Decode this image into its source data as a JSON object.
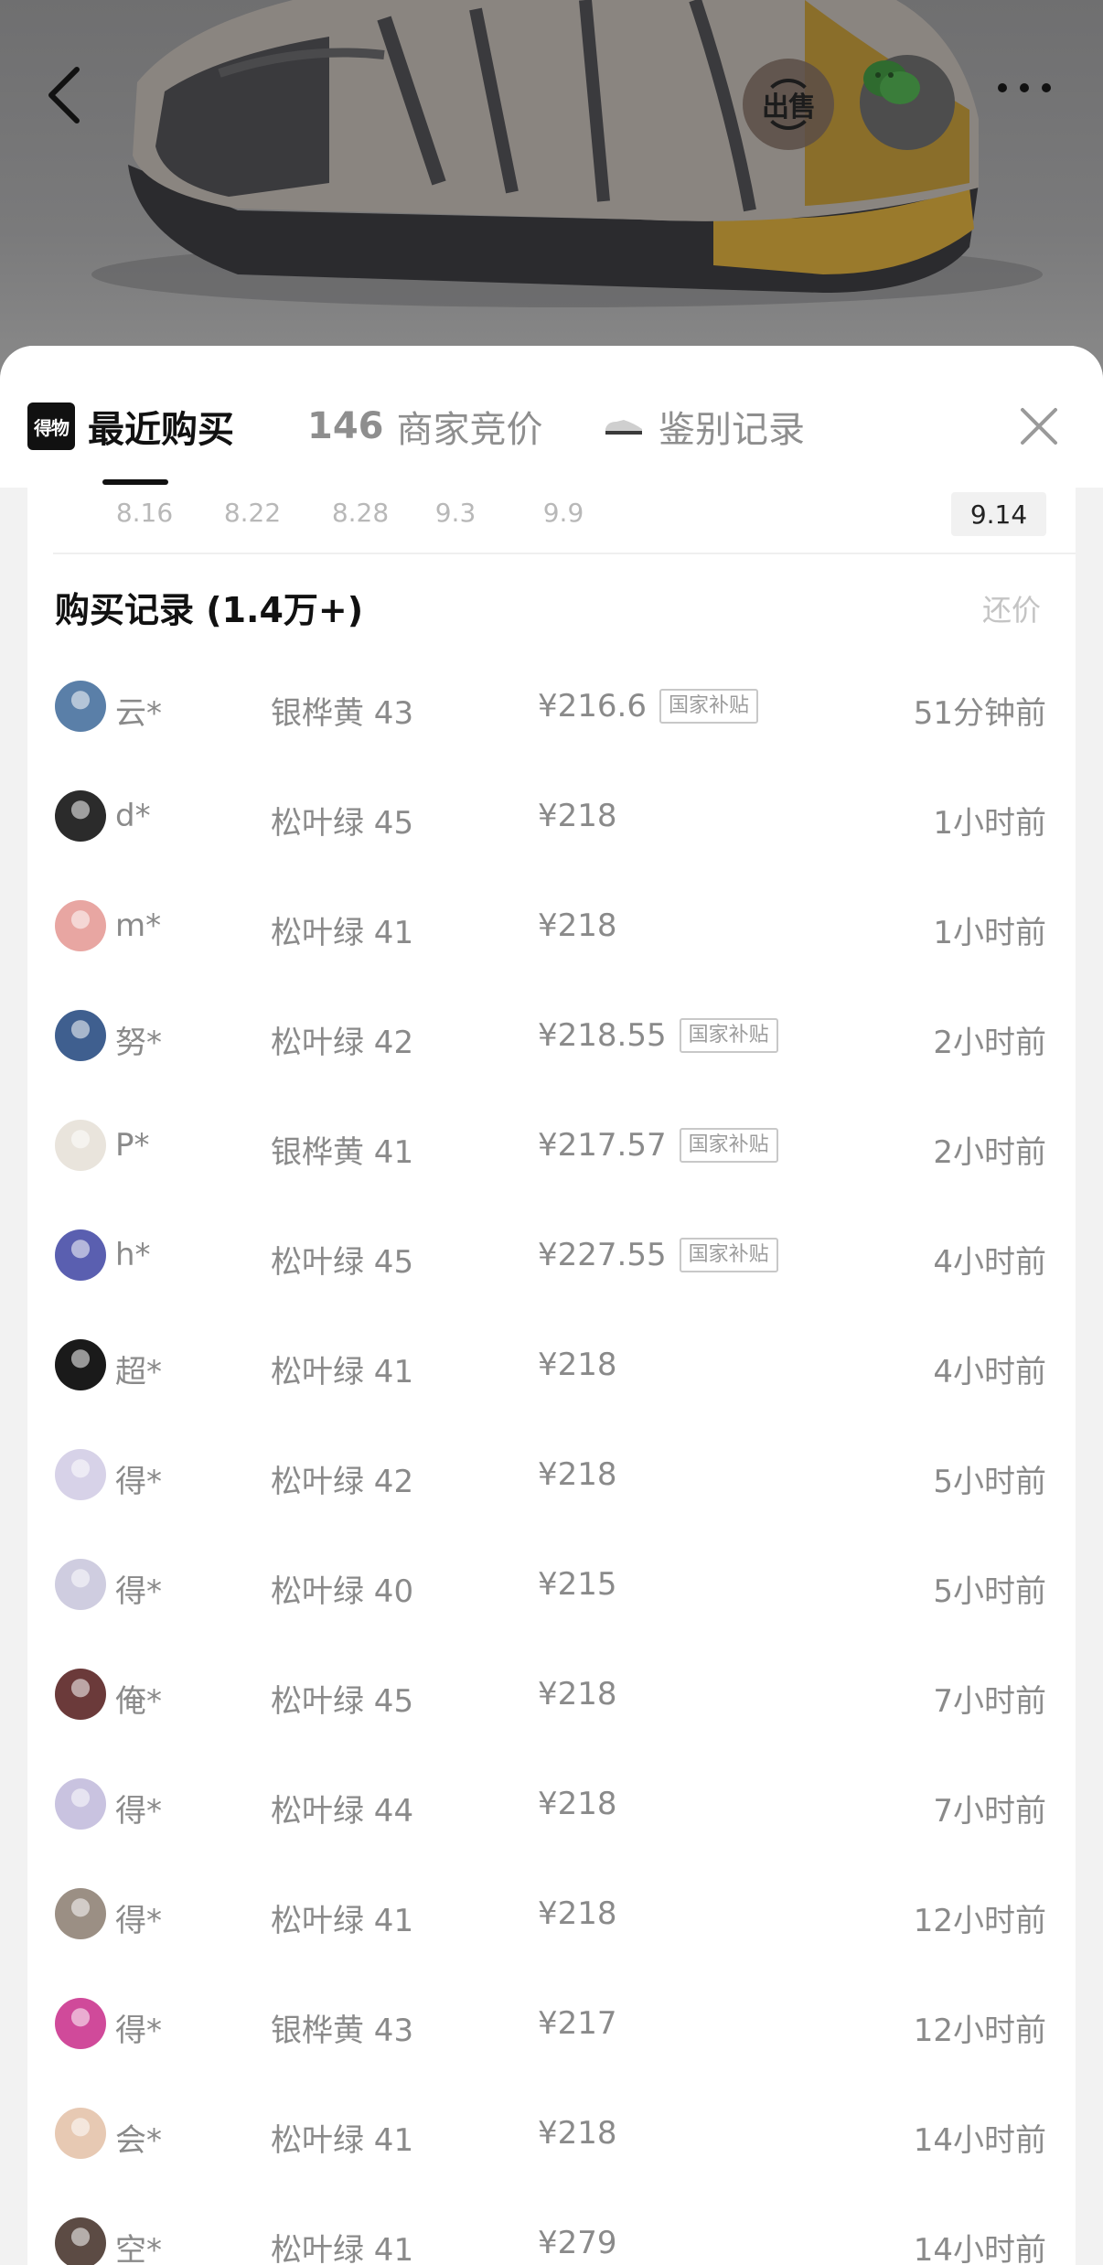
{
  "header": {
    "sell_label": "出售"
  },
  "sheet": {
    "logo_text": "得物",
    "tabs": [
      {
        "label": "最近购买"
      },
      {
        "count": "146",
        "label": "商家竞价"
      },
      {
        "label": "鉴别记录"
      }
    ]
  },
  "date_axis": {
    "labels": [
      "8.16",
      "8.22",
      "8.28",
      "9.3",
      "9.9"
    ],
    "selected": "9.14"
  },
  "records": {
    "title": "购买记录 (1.4万+)",
    "counter_offer": "还价",
    "subsidy_tag": "国家补贴",
    "rows": [
      {
        "user": "云*",
        "variant": "银桦黄 43",
        "price": "¥216.6",
        "subsidy": true,
        "time": "51分钟前",
        "avatar_color": "#5a7fa8"
      },
      {
        "user": "d*",
        "variant": "松叶绿 45",
        "price": "¥218",
        "subsidy": false,
        "time": "1小时前",
        "avatar_color": "#2b2b2b"
      },
      {
        "user": "m*",
        "variant": "松叶绿 41",
        "price": "¥218",
        "subsidy": false,
        "time": "1小时前",
        "avatar_color": "#e8a6a2"
      },
      {
        "user": "努*",
        "variant": "松叶绿 42",
        "price": "¥218.55",
        "subsidy": true,
        "time": "2小时前",
        "avatar_color": "#3f5f8f"
      },
      {
        "user": "P*",
        "variant": "银桦黄 41",
        "price": "¥217.57",
        "subsidy": true,
        "time": "2小时前",
        "avatar_color": "#e9e4dc"
      },
      {
        "user": "h*",
        "variant": "松叶绿 45",
        "price": "¥227.55",
        "subsidy": true,
        "time": "4小时前",
        "avatar_color": "#5a5fb0"
      },
      {
        "user": "超*",
        "variant": "松叶绿 41",
        "price": "¥218",
        "subsidy": false,
        "time": "4小时前",
        "avatar_color": "#1a1a1a"
      },
      {
        "user": "得*",
        "variant": "松叶绿 42",
        "price": "¥218",
        "subsidy": false,
        "time": "5小时前",
        "avatar_color": "#d7d2e8"
      },
      {
        "user": "得*",
        "variant": "松叶绿 40",
        "price": "¥215",
        "subsidy": false,
        "time": "5小时前",
        "avatar_color": "#cfcde0"
      },
      {
        "user": "俺*",
        "variant": "松叶绿 45",
        "price": "¥218",
        "subsidy": false,
        "time": "7小时前",
        "avatar_color": "#6b3a3a"
      },
      {
        "user": "得*",
        "variant": "松叶绿 44",
        "price": "¥218",
        "subsidy": false,
        "time": "7小时前",
        "avatar_color": "#c9c3e0"
      },
      {
        "user": "得*",
        "variant": "松叶绿 41",
        "price": "¥218",
        "subsidy": false,
        "time": "12小时前",
        "avatar_color": "#9b8f84"
      },
      {
        "user": "得*",
        "variant": "银桦黄 43",
        "price": "¥217",
        "subsidy": false,
        "time": "12小时前",
        "avatar_color": "#d04a9a"
      },
      {
        "user": "会*",
        "variant": "松叶绿 41",
        "price": "¥218",
        "subsidy": false,
        "time": "14小时前",
        "avatar_color": "#e7c9b3"
      },
      {
        "user": "空*",
        "variant": "松叶绿 41",
        "price": "¥279",
        "subsidy": false,
        "time": "14小时前",
        "avatar_color": "#5c4b44"
      }
    ]
  }
}
